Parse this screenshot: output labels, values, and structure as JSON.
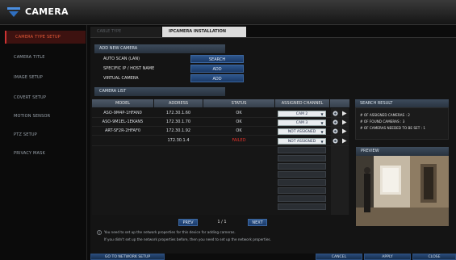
{
  "app": {
    "title": "CAMERA"
  },
  "sidebar": {
    "items": [
      {
        "label": "CAMERA TYPE SETUP",
        "active": true
      },
      {
        "label": "CAMERA TITLE"
      },
      {
        "label": "IMAGE SETUP"
      },
      {
        "label": "COVERT SETUP"
      },
      {
        "label": "MOTION SENSOR"
      },
      {
        "label": "PTZ SETUP"
      },
      {
        "label": "PRIVACY MASK"
      }
    ]
  },
  "tabs": [
    {
      "label": "CABLE TYPE",
      "active": false
    },
    {
      "label": "IPCAMERA INSTALLATION",
      "active": true
    }
  ],
  "add_new": {
    "header": "ADD NEW CAMERA",
    "rows": [
      {
        "label": "AUTO SCAN (LAN)",
        "button": "SEARCH"
      },
      {
        "label": "SPECIFIC IP / HOST NAME",
        "button": "ADD"
      },
      {
        "label": "VIRTUAL CAMERA",
        "button": "ADD"
      }
    ]
  },
  "camera_list": {
    "header": "CAMERA LIST",
    "columns": [
      "MODEL",
      "ADDRESS",
      "STATUS",
      "ASSIGNED CHANNEL"
    ],
    "rows": [
      {
        "model": "ASO-9M4P-1HFAN0",
        "address": "172.30.1.60",
        "status": "OK",
        "channel": "CAM 2"
      },
      {
        "model": "ASO-9M1EL-1EKAN5",
        "address": "172.30.1.70",
        "status": "OK",
        "channel": "CAM 3"
      },
      {
        "model": "ART-SF2R-2HFAF0",
        "address": "172.30.1.92",
        "status": "OK",
        "channel": "NOT ASSIGNED"
      },
      {
        "model": "",
        "address": "172.30.1.4",
        "status": "FAILED",
        "channel": "NOT ASSIGNED"
      }
    ],
    "empty_rows": 9
  },
  "pager": {
    "prev": "PREV",
    "page": "1 / 1",
    "next": "NEXT"
  },
  "notes": [
    "You need to set up the network properties for this device for adding cameras.",
    "If you didn't set up the network properties before, then you need to set up the network properties."
  ],
  "search_result": {
    "header": "SEARCH RESULT",
    "lines": [
      "# OF ASSIGNED CAMERAS : 2",
      "# OF FOUND CAMERAS : 3",
      "# OF CAMERAS NEEDED TO BE SET : 1"
    ]
  },
  "preview": {
    "header": "PREVIEW"
  },
  "bottom": {
    "network_setup": "GO TO NETWORK SETUP",
    "cancel": "CANCEL",
    "apply": "APPLY",
    "close": "CLOSE"
  },
  "colors": {
    "accent_red": "#e85a38",
    "button_blue": "#2e568c",
    "failed_text": "#e0312a"
  }
}
